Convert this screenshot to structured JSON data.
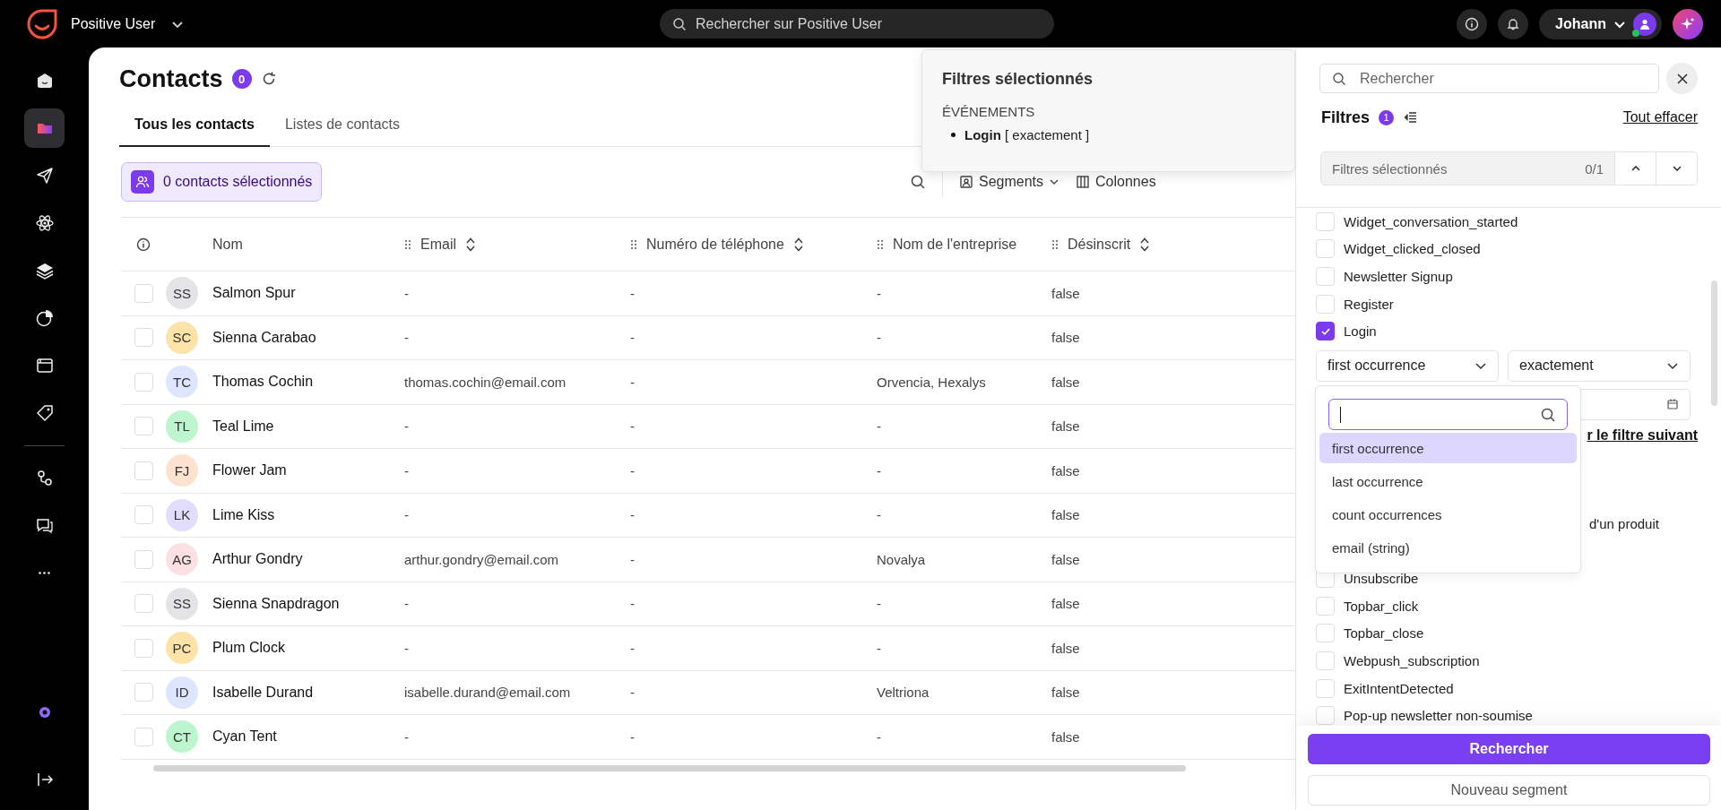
{
  "app": {
    "name": "Positive User"
  },
  "search": {
    "placeholder": "Rechercher sur Positive User"
  },
  "user": {
    "name": "Johann",
    "online": true
  },
  "sidebar": {
    "main_items": [
      {
        "kind": "home",
        "selected": false
      },
      {
        "kind": "folder",
        "selected": true
      },
      {
        "kind": "send",
        "selected": false
      },
      {
        "kind": "atom",
        "selected": false
      },
      {
        "kind": "layers",
        "selected": false
      },
      {
        "kind": "pie",
        "selected": false
      },
      {
        "kind": "window",
        "selected": false
      },
      {
        "kind": "tag",
        "selected": false
      }
    ],
    "secondary_items": [
      {
        "kind": "flow",
        "selected": false
      },
      {
        "kind": "chat",
        "selected": false
      },
      {
        "kind": "more",
        "selected": false
      }
    ],
    "bottom_items": [
      {
        "kind": "brand"
      },
      {
        "kind": "logout"
      }
    ]
  },
  "page": {
    "title": "Contacts",
    "count": "0"
  },
  "tabs": [
    {
      "label": "Tous les contacts",
      "selected": true
    },
    {
      "label": "Listes de contacts",
      "selected": false
    }
  ],
  "selection": {
    "label": "0 contacts sélectionnés"
  },
  "toolbar": [
    {
      "kind": "search"
    },
    {
      "kind": "segments",
      "label": "Segments"
    },
    {
      "kind": "columns",
      "label": "Colonnes"
    }
  ],
  "table": {
    "columns": [
      {
        "label": "Nom",
        "draggable": false,
        "sortable": false
      },
      {
        "label": "Email",
        "draggable": true,
        "sortable": true
      },
      {
        "label": "Numéro de téléphone",
        "draggable": true,
        "sortable": true
      },
      {
        "label": "Nom de l'entreprise",
        "draggable": true,
        "sortable": false
      },
      {
        "label": "Désinscrit",
        "draggable": true,
        "sortable": true
      }
    ],
    "rows": [
      {
        "checked": false,
        "initials": "SS",
        "color": "#e4e4e7",
        "name": "Salmon Spur",
        "email": "-",
        "phone": "-",
        "company": "-",
        "unsubscribed": "false"
      },
      {
        "checked": false,
        "initials": "SC",
        "color": "#fde3a7",
        "name": "Sienna Carabao",
        "email": "-",
        "phone": "-",
        "company": "-",
        "unsubscribed": "false"
      },
      {
        "checked": false,
        "initials": "TC",
        "color": "#dde5ff",
        "name": "Thomas Cochin",
        "email": "thomas.cochin@email.com",
        "phone": "-",
        "company": "Orvencia, Hexalys",
        "unsubscribed": "false"
      },
      {
        "checked": false,
        "initials": "TL",
        "color": "#bdf5cf",
        "name": "Teal Lime",
        "email": "-",
        "phone": "-",
        "company": "-",
        "unsubscribed": "false"
      },
      {
        "checked": false,
        "initials": "FJ",
        "color": "#fde2cf",
        "name": "Flower Jam",
        "email": "-",
        "phone": "-",
        "company": "-",
        "unsubscribed": "false"
      },
      {
        "checked": false,
        "initials": "LK",
        "color": "#e2dcfd",
        "name": "Lime Kiss",
        "email": "-",
        "phone": "-",
        "company": "-",
        "unsubscribed": "false"
      },
      {
        "checked": false,
        "initials": "AG",
        "color": "#fde0e2",
        "name": "Arthur Gondry",
        "email": "arthur.gondry@email.com",
        "phone": "-",
        "company": "Novalya",
        "unsubscribed": "false"
      },
      {
        "checked": false,
        "initials": "SS",
        "color": "#e4e4e7",
        "name": "Sienna Snapdragon",
        "email": "-",
        "phone": "-",
        "company": "-",
        "unsubscribed": "false"
      },
      {
        "checked": false,
        "initials": "PC",
        "color": "#fde3a7",
        "name": "Plum Clock",
        "email": "-",
        "phone": "-",
        "company": "-",
        "unsubscribed": "false"
      },
      {
        "checked": false,
        "initials": "ID",
        "color": "#dde5ff",
        "name": "Isabelle Durand",
        "email": "isabelle.durand@email.com",
        "phone": "-",
        "company": "Veltriona",
        "unsubscribed": "false"
      },
      {
        "checked": false,
        "initials": "CT",
        "color": "#bdf5cf",
        "name": "Cyan Tent",
        "email": "-",
        "phone": "-",
        "company": "-",
        "unsubscribed": "false"
      }
    ]
  },
  "popover": {
    "title": "Filtres sélectionnés",
    "section": "ÉVÉNEMENTS",
    "items": [
      {
        "name": "Login",
        "detail": "[ exactement ]"
      }
    ]
  },
  "filter_panel": {
    "search_placeholder": "Rechercher",
    "title": "Filtres",
    "count": "1",
    "clear": "Tout effacer",
    "selected_bar": {
      "label": "Filtres sélectionnés",
      "counter": "0/1"
    },
    "events": [
      {
        "kind": "checkbox",
        "label": "Widget_conversation_started",
        "checked": false
      },
      {
        "kind": "checkbox",
        "label": "Widget_clicked_closed",
        "checked": false
      },
      {
        "kind": "checkbox",
        "label": "Newsletter Signup",
        "checked": false
      },
      {
        "kind": "checkbox",
        "label": "Register",
        "checked": false
      },
      {
        "kind": "checkbox",
        "label": "Login",
        "checked": true
      },
      {
        "kind": "config",
        "occurrence": "first occurrence",
        "operator": "exactement",
        "link": "r le filtre suivant"
      },
      {
        "kind": "hidden"
      },
      {
        "kind": "hidden"
      },
      {
        "kind": "partial",
        "label": "d'un produit"
      },
      {
        "kind": "hidden"
      },
      {
        "kind": "checkbox",
        "label": "Unsubscribe",
        "checked": false
      },
      {
        "kind": "checkbox",
        "label": "Topbar_click",
        "checked": false
      },
      {
        "kind": "checkbox",
        "label": "Topbar_close",
        "checked": false
      },
      {
        "kind": "checkbox",
        "label": "Webpush_subscription",
        "checked": false
      },
      {
        "kind": "checkbox",
        "label": "ExitIntentDetected",
        "checked": false
      },
      {
        "kind": "checkbox",
        "label": "Pop-up newsletter non-soumise",
        "checked": false
      }
    ],
    "dropdown": {
      "options": [
        {
          "label": "first occurrence",
          "selected": true
        },
        {
          "label": "last occurrence",
          "selected": false
        },
        {
          "label": "count occurrences",
          "selected": false
        },
        {
          "label": "email (string)",
          "selected": false
        }
      ]
    },
    "search_button": "Rechercher",
    "segment_button": "Nouveau segment"
  }
}
